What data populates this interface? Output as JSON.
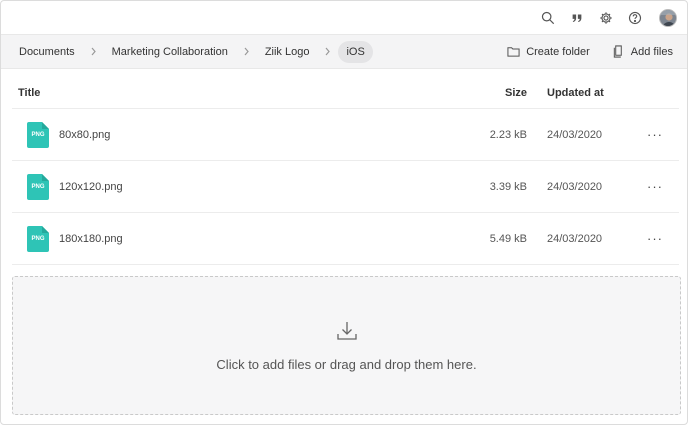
{
  "topbar": {
    "icons": [
      "search-icon",
      "quote-icon",
      "gear-icon",
      "help-icon",
      "avatar"
    ]
  },
  "breadcrumb": {
    "items": [
      "Documents",
      "Marketing Collaboration",
      "Ziik Logo",
      "iOS"
    ]
  },
  "actions": {
    "create_folder": "Create folder",
    "add_files": "Add files"
  },
  "table": {
    "headers": {
      "title": "Title",
      "size": "Size",
      "updated": "Updated at"
    },
    "rows": [
      {
        "type": "PNG",
        "name": "80x80.png",
        "size": "2.23 kB",
        "updated": "24/03/2020"
      },
      {
        "type": "PNG",
        "name": "120x120.png",
        "size": "3.39 kB",
        "updated": "24/03/2020"
      },
      {
        "type": "PNG",
        "name": "180x180.png",
        "size": "5.49 kB",
        "updated": "24/03/2020"
      }
    ],
    "menu_glyph": "···"
  },
  "dropzone": {
    "message": "Click to add files or drag and drop them here."
  },
  "colors": {
    "file_icon": "#2ec4b6",
    "crumb_bar": "#f4f4f5"
  }
}
